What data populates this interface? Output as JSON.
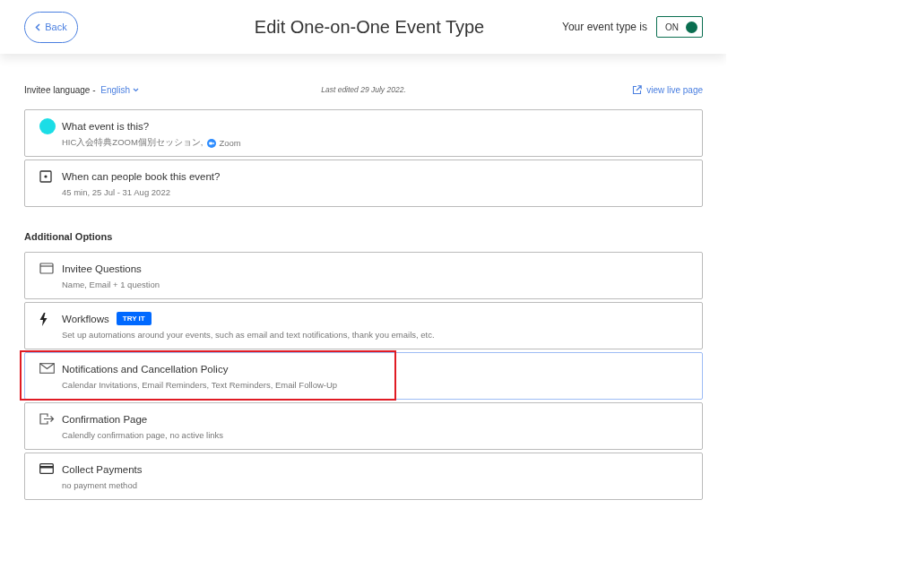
{
  "header": {
    "back": "Back",
    "title": "Edit One-on-One Event Type",
    "status_label": "Your event type is",
    "toggle": {
      "label": "ON",
      "on": true
    }
  },
  "info_bar": {
    "language_label": "Invitee language - ",
    "language": "English",
    "last_edited": "Last edited 29 July 2022.",
    "live_link": "view live page"
  },
  "event_cards": [
    {
      "kind": "color",
      "color": "#1bdde6",
      "title": "What event is this?",
      "subtitle": "HIC入会特典ZOOM個別セッション, ",
      "location": "Zoom"
    },
    {
      "kind": "calendar",
      "title": "When can people book this event?",
      "subtitle": "45 min, 25 Jul - 31 Aug 2022"
    }
  ],
  "section_title": "Additional Options",
  "options": [
    {
      "kind": "form",
      "title": "Invitee Questions",
      "subtitle": "Name, Email + 1 question",
      "highlighted": false
    },
    {
      "kind": "bolt",
      "title": "Workflows",
      "badge": "TRY IT",
      "subtitle": "Set up automations around your events, such as email and text notifications, thank you emails, etc.",
      "highlighted": false
    },
    {
      "kind": "mail",
      "title": "Notifications and Cancellation Policy",
      "subtitle": "Calendar Invitations, Email Reminders, Text Reminders, Email Follow-Up",
      "highlighted": true
    },
    {
      "kind": "exit",
      "title": "Confirmation Page",
      "subtitle": "Calendly confirmation page, no active links",
      "highlighted": false
    },
    {
      "kind": "card",
      "title": "Collect Payments",
      "subtitle": "no payment method",
      "highlighted": false
    }
  ]
}
